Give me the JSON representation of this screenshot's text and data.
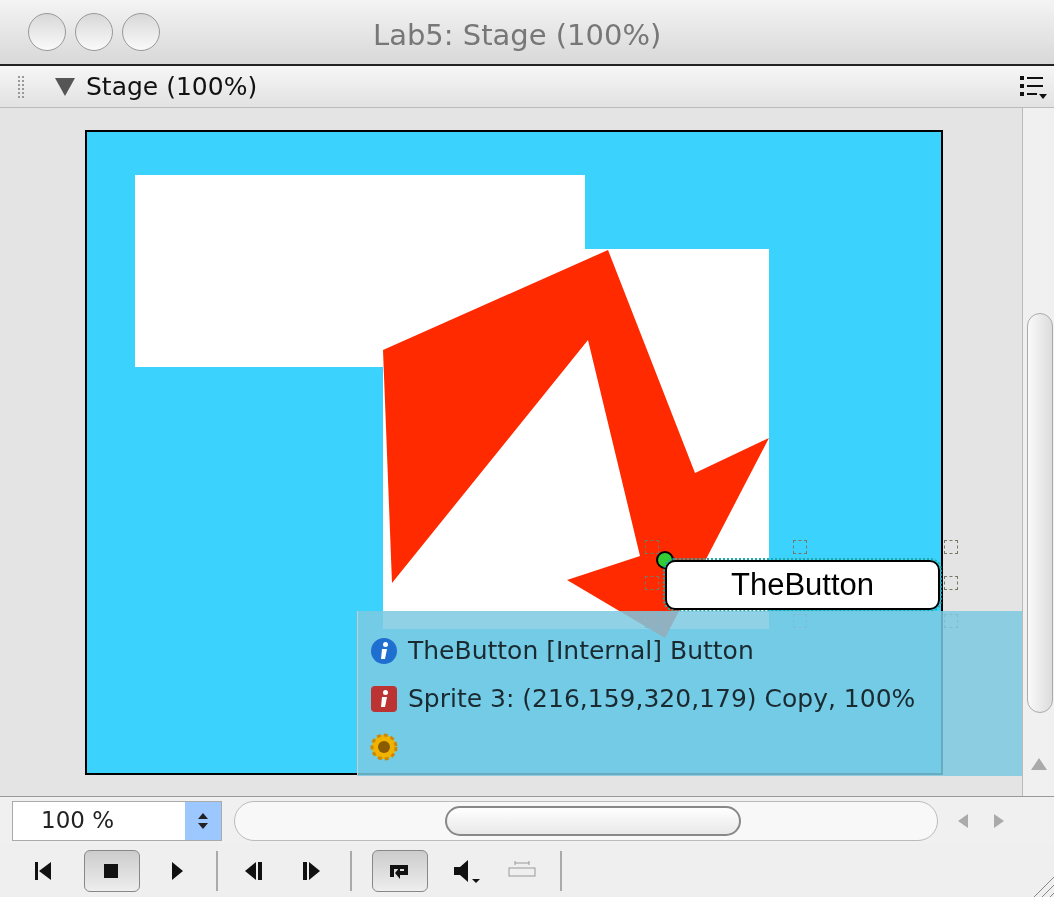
{
  "window": {
    "title": "Lab5: Stage (100%)"
  },
  "panel": {
    "title": "Stage (100%)",
    "expanded": true
  },
  "stage": {
    "sprite_button": {
      "label": "TheButton",
      "selected": true
    },
    "info_rows": [
      {
        "kind": "info",
        "text": "TheButton [Internal] Button"
      },
      {
        "kind": "sprite",
        "text": "Sprite 3: (216,159,320,179) Copy, 100%"
      },
      {
        "kind": "behavior"
      }
    ]
  },
  "zoom": {
    "value": "100 %"
  },
  "toolbar": [
    {
      "kind": "rewind",
      "selected": false
    },
    {
      "kind": "stop",
      "selected": true
    },
    {
      "kind": "play",
      "selected": false
    },
    {
      "kind": "sep"
    },
    {
      "kind": "step-back",
      "selected": false
    },
    {
      "kind": "step-forward",
      "selected": false
    },
    {
      "kind": "sep"
    },
    {
      "kind": "loop",
      "selected": true
    },
    {
      "kind": "volume",
      "selected": false
    },
    {
      "kind": "selected-frames",
      "selected": false
    },
    {
      "kind": "sep"
    }
  ]
}
